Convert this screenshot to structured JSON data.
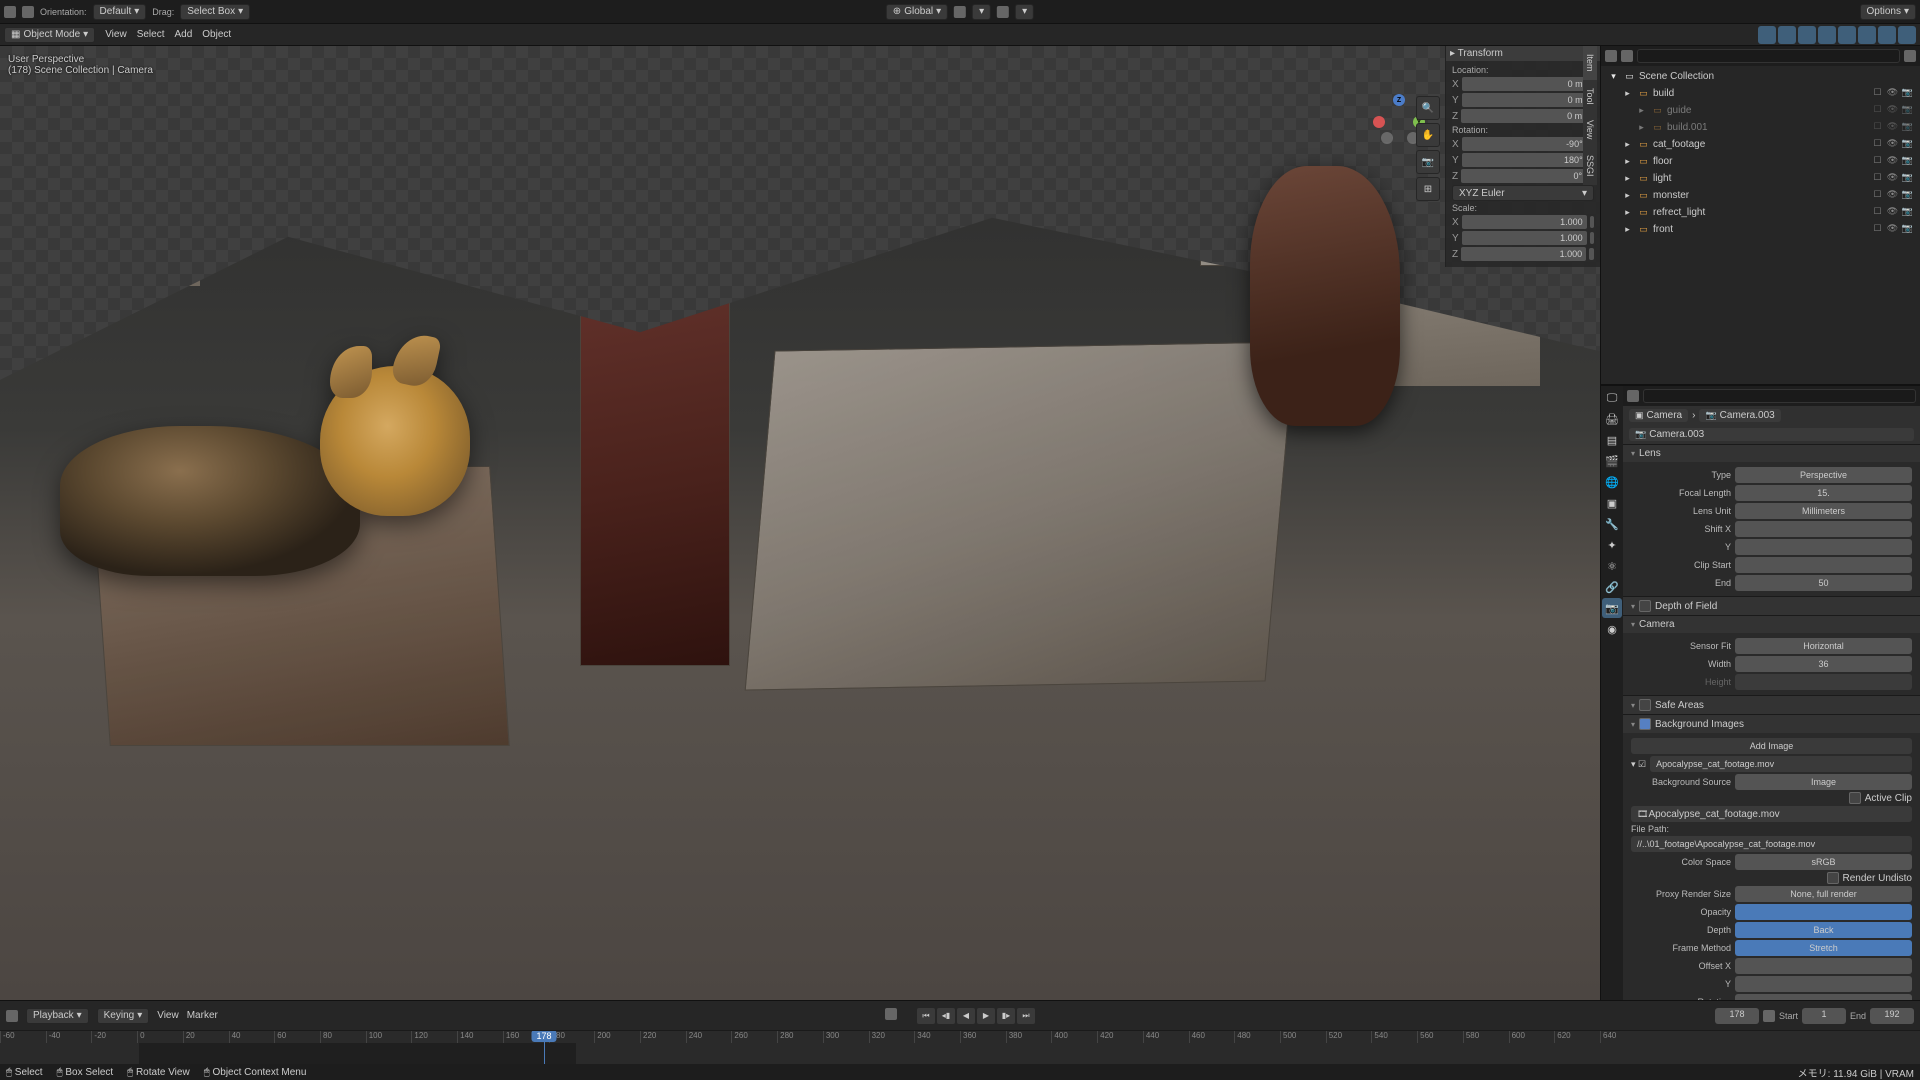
{
  "header": {
    "orientation_label": "Orientation:",
    "orientation_value": "Default",
    "drag_label": "Drag:",
    "drag_value": "Select Box",
    "transform_orientation": "Global",
    "options": "Options"
  },
  "menubar": {
    "mode": "Object Mode",
    "menus": [
      "View",
      "Select",
      "Add",
      "Object"
    ]
  },
  "viewport_overlay": {
    "line1": "User Perspective",
    "line2": "(178) Scene Collection | Camera"
  },
  "npanel": {
    "tabs": [
      "Item",
      "Tool",
      "View",
      "SSGI"
    ],
    "transform_header": "Transform",
    "location_label": "Location:",
    "location": {
      "x": "0 m",
      "y": "0 m",
      "z": "0 m"
    },
    "rotation_label": "Rotation:",
    "rotation": {
      "x": "-90°",
      "y": "180°",
      "z": "0°"
    },
    "rotation_mode": "XYZ Euler",
    "scale_label": "Scale:",
    "scale": {
      "x": "1.000",
      "y": "1.000",
      "z": "1.000"
    }
  },
  "outliner": {
    "root": "Scene Collection",
    "items": [
      {
        "name": "build",
        "indent": 1,
        "type": "collection"
      },
      {
        "name": "guide",
        "indent": 2,
        "type": "empty",
        "muted": true
      },
      {
        "name": "build.001",
        "indent": 2,
        "type": "empty",
        "muted": true
      },
      {
        "name": "cat_footage",
        "indent": 1,
        "type": "collection"
      },
      {
        "name": "floor",
        "indent": 1,
        "type": "collection"
      },
      {
        "name": "light",
        "indent": 1,
        "type": "collection"
      },
      {
        "name": "monster",
        "indent": 1,
        "type": "collection"
      },
      {
        "name": "refrect_light",
        "indent": 1,
        "type": "collection"
      },
      {
        "name": "front",
        "indent": 1,
        "type": "collection"
      }
    ]
  },
  "properties": {
    "breadcrumb1": "Camera",
    "breadcrumb2": "Camera.003",
    "datablock": "Camera.003",
    "lens_header": "Lens",
    "type_label": "Type",
    "type_value": "Perspective",
    "focal_label": "Focal Length",
    "focal_value": "15.",
    "lens_unit_label": "Lens Unit",
    "lens_unit_value": "Millimeters",
    "shift_label": "Shift X",
    "shift_y_label": "Y",
    "clip_start_label": "Clip Start",
    "clip_end_label": "End",
    "clip_end_value": "50",
    "dof_header": "Depth of Field",
    "camera_header": "Camera",
    "sensor_fit_label": "Sensor Fit",
    "sensor_fit_value": "Horizontal",
    "width_label": "Width",
    "width_value": "36",
    "height_label": "Height",
    "safe_areas_header": "Safe Areas",
    "bg_header": "Background Images",
    "add_image": "Add Image",
    "bg_name": "Apocalypse_cat_footage.mov",
    "bg_source_label": "Background Source",
    "bg_source_value": "Image",
    "active_clip": "Active Clip",
    "clip_name": "Apocalypse_cat_footage.mov",
    "file_path_label": "File Path:",
    "file_path_value": "//..\\01_footage\\Apocalypse_cat_footage.mov",
    "color_space_label": "Color Space",
    "color_space_value": "sRGB",
    "render_undist": "Render Undisto",
    "proxy_label": "Proxy Render Size",
    "proxy_value": "None, full render",
    "opacity_label": "Opacity",
    "depth_label": "Depth",
    "depth_value": "Back",
    "frame_method_label": "Frame Method",
    "frame_method_value": "Stretch",
    "offset_x_label": "Offset X",
    "offset_y_label": "Y",
    "rotation_label": "Rotation"
  },
  "timeline": {
    "playback": "Playback",
    "keying": "Keying",
    "view": "View",
    "marker": "Marker",
    "current": "178",
    "start_label": "Start",
    "start_value": "1",
    "end_label": "End",
    "end_value": "192",
    "ticks": [
      "-60",
      "-40",
      "-20",
      "0",
      "20",
      "40",
      "60",
      "80",
      "100",
      "120",
      "140",
      "160",
      "180",
      "200",
      "220",
      "240",
      "260",
      "280",
      "300",
      "320",
      "340",
      "360",
      "380",
      "400",
      "420",
      "440",
      "460",
      "480",
      "500",
      "520",
      "540",
      "560",
      "580",
      "600",
      "620",
      "640"
    ]
  },
  "statusbar": {
    "select": "Select",
    "box_select": "Box Select",
    "rotate_view": "Rotate View",
    "context_menu": "Object Context Menu",
    "memory": "メモリ: 11.94 GiB | VRAM"
  }
}
